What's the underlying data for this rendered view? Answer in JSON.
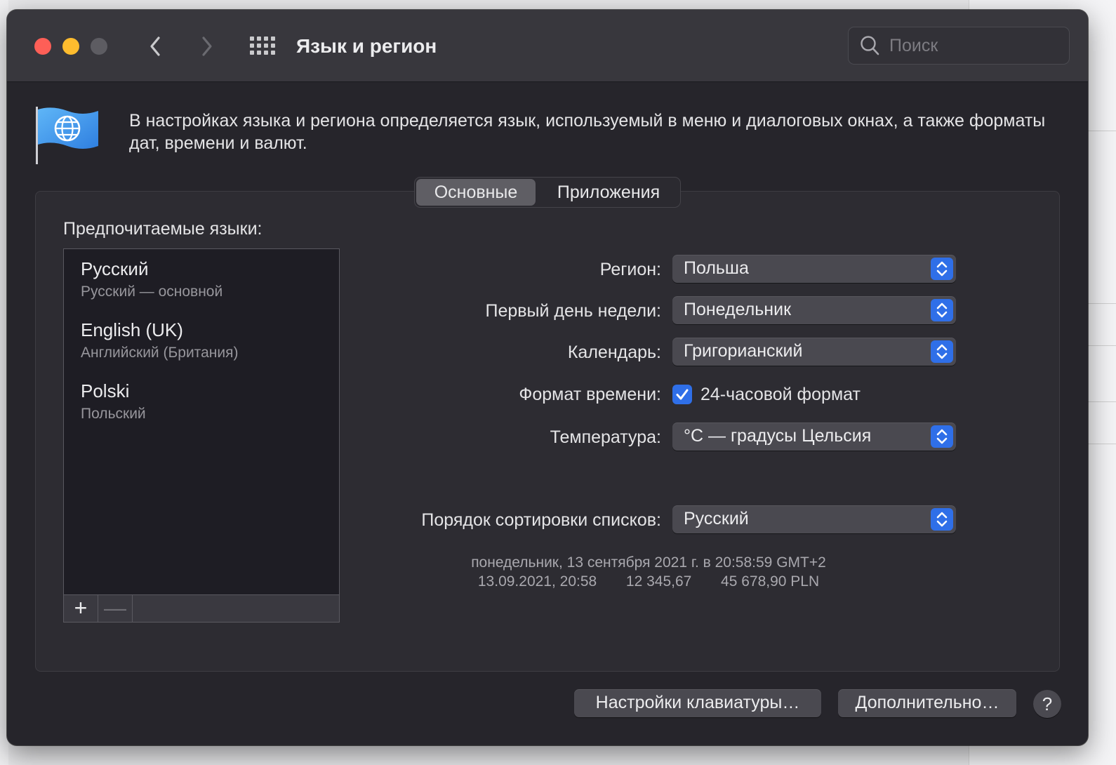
{
  "window": {
    "title": "Язык и регион",
    "search_placeholder": "Поиск",
    "icons": [
      "close",
      "minimize",
      "zoom",
      "chevron-left-icon",
      "chevron-right-icon",
      "grid-icon",
      "search-icon",
      "flag-globe-icon"
    ]
  },
  "intro": {
    "text": "В настройках языка и региона определяется язык, используемый в меню и диалоговых окнах, а также форматы дат, времени и валют."
  },
  "tabs": [
    {
      "label": "Основные",
      "selected": true
    },
    {
      "label": "Приложения",
      "selected": false
    }
  ],
  "languages": {
    "label": "Предпочитаемые языки:",
    "items": [
      {
        "name": "Русский",
        "sub": "Русский — основной"
      },
      {
        "name": "English (UK)",
        "sub": "Английский (Британия)"
      },
      {
        "name": "Polski",
        "sub": "Польский"
      }
    ],
    "add_symbol": "+",
    "remove_symbol": "—"
  },
  "settings": {
    "region": {
      "label": "Регион:",
      "value": "Польша"
    },
    "first_day": {
      "label": "Первый день недели:",
      "value": "Понедельник"
    },
    "calendar": {
      "label": "Календарь:",
      "value": "Григорианский"
    },
    "time_format": {
      "label": "Формат времени:",
      "checkbox_label": "24-часовой формат",
      "checked": true
    },
    "temperature": {
      "label": "Температура:",
      "value": "°C — градусы Цельсия"
    },
    "sort_order": {
      "label": "Порядок сортировки списков:",
      "value": "Русский"
    }
  },
  "sample": {
    "line1": "понедельник, 13 сентября 2021 г. в 20:58:59 GMT+2",
    "date_short": "13.09.2021, 20:58",
    "number": "12 345,67",
    "currency": "45 678,90 PLN"
  },
  "buttons": {
    "keyboard": "Настройки клавиатуры…",
    "advanced": "Дополнительно…",
    "help": "?"
  },
  "colors": {
    "window_bg": "#26252b",
    "titlebar_bg": "#38373d",
    "accent": "#2f6fe8",
    "close": "#fe5f57",
    "minimize": "#febc2e"
  }
}
